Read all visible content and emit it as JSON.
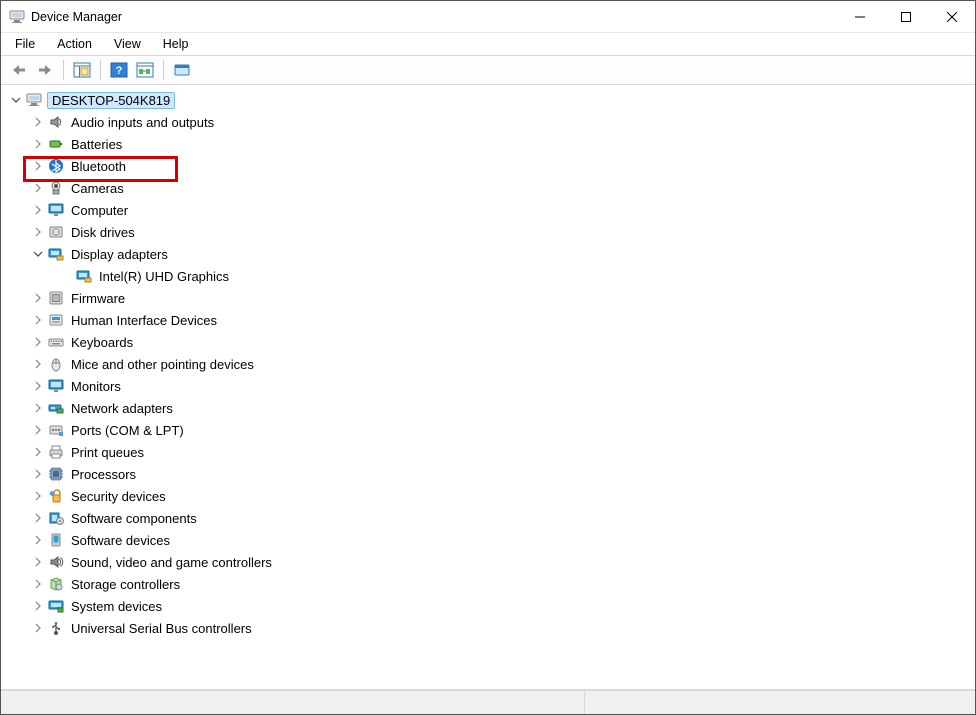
{
  "window": {
    "title": "Device Manager"
  },
  "menu": {
    "file": "File",
    "action": "Action",
    "view": "View",
    "help": "Help"
  },
  "toolbar_icons": {
    "back": "back-arrow-icon",
    "forward": "forward-arrow-icon",
    "show_hidden": "show-hidden-devices-icon",
    "help": "help-icon",
    "scan": "scan-hardware-icon",
    "properties": "properties-icon"
  },
  "tree": {
    "root": {
      "label": "DESKTOP-504K819",
      "expanded": true,
      "icon": "computer-root-icon"
    },
    "categories": [
      {
        "label": "Audio inputs and outputs",
        "icon": "speaker-icon",
        "expanded": false
      },
      {
        "label": "Batteries",
        "icon": "battery-icon",
        "expanded": false
      },
      {
        "label": "Bluetooth",
        "icon": "bluetooth-icon",
        "expanded": false
      },
      {
        "label": "Cameras",
        "icon": "camera-icon",
        "expanded": false
      },
      {
        "label": "Computer",
        "icon": "monitor-icon",
        "expanded": false
      },
      {
        "label": "Disk drives",
        "icon": "disk-icon",
        "expanded": false
      },
      {
        "label": "Display adapters",
        "icon": "display-adapter-icon",
        "expanded": true,
        "highlight": true,
        "children": [
          {
            "label": "Intel(R) UHD Graphics",
            "icon": "display-adapter-icon"
          }
        ]
      },
      {
        "label": "Firmware",
        "icon": "firmware-icon",
        "expanded": false
      },
      {
        "label": "Human Interface Devices",
        "icon": "hid-icon",
        "expanded": false
      },
      {
        "label": "Keyboards",
        "icon": "keyboard-icon",
        "expanded": false
      },
      {
        "label": "Mice and other pointing devices",
        "icon": "mouse-icon",
        "expanded": false
      },
      {
        "label": "Monitors",
        "icon": "monitor-icon",
        "expanded": false
      },
      {
        "label": "Network adapters",
        "icon": "network-adapter-icon",
        "expanded": false
      },
      {
        "label": "Ports (COM & LPT)",
        "icon": "port-icon",
        "expanded": false
      },
      {
        "label": "Print queues",
        "icon": "printer-icon",
        "expanded": false
      },
      {
        "label": "Processors",
        "icon": "processor-icon",
        "expanded": false
      },
      {
        "label": "Security devices",
        "icon": "security-icon",
        "expanded": false
      },
      {
        "label": "Software components",
        "icon": "software-component-icon",
        "expanded": false
      },
      {
        "label": "Software devices",
        "icon": "software-device-icon",
        "expanded": false
      },
      {
        "label": "Sound, video and game controllers",
        "icon": "sound-icon",
        "expanded": false
      },
      {
        "label": "Storage controllers",
        "icon": "storage-icon",
        "expanded": false
      },
      {
        "label": "System devices",
        "icon": "system-device-icon",
        "expanded": false
      },
      {
        "label": "Universal Serial Bus controllers",
        "icon": "usb-icon",
        "expanded": false
      }
    ]
  }
}
